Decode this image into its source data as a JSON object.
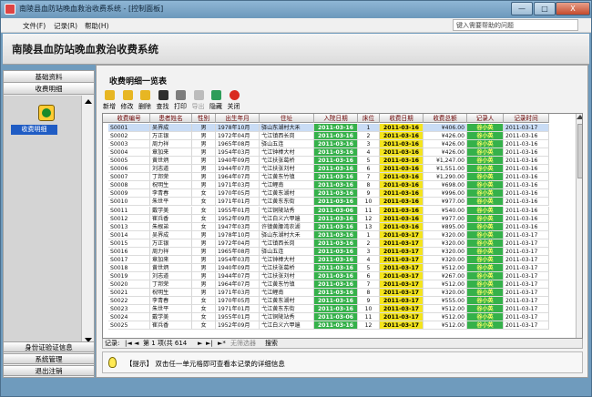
{
  "window": {
    "title": "南陵县血防站晚血救治收费系统 - [控制面板]",
    "buttons": [
      "—",
      "□",
      "X"
    ]
  },
  "menu": {
    "items": [
      "文件(F)",
      "记录(R)",
      "帮助(H)"
    ],
    "help_placeholder": "键入需要帮助的问题"
  },
  "header": {
    "app_title": "南陵县血防站晚血救治收费系统"
  },
  "leftnav": {
    "sections": [
      "基础资料",
      "收费明细"
    ],
    "selected_item": "收费明细",
    "icon": "coins-icon",
    "bottom_sections": [
      "身份证验证信息",
      "系统管理",
      "退出注销"
    ]
  },
  "main": {
    "title": "收费明细一览表",
    "toolbar": [
      {
        "label": "新增",
        "icon": "new-folder-icon",
        "color": "#e7b623"
      },
      {
        "label": "修改",
        "icon": "edit-icon",
        "color": "#e7b623"
      },
      {
        "label": "删除",
        "icon": "delete-icon",
        "color": "#e7b623"
      },
      {
        "label": "查找",
        "icon": "binoculars-icon",
        "color": "#2f2f2f"
      },
      {
        "label": "打印",
        "icon": "printer-icon",
        "color": "#7d7d7d"
      },
      {
        "label": "导出",
        "icon": "export-icon",
        "color": "#bcbcbc"
      },
      {
        "label": "隐藏",
        "icon": "hide-arrow-icon",
        "color": "#2e9d5a"
      },
      {
        "label": "关闭",
        "icon": "close-circle-icon",
        "color": "#d92b1f"
      }
    ],
    "columns": [
      "收费编号",
      "患者姓名",
      "性别",
      "出生年月",
      "住址",
      "入院日期",
      "床位",
      "收费日期",
      "收费总额",
      "记录人",
      "记录时间"
    ],
    "rows": [
      [
        "S0001",
        "吴界成",
        "男",
        "1978年10月",
        "驿山东湖村大禾",
        "2011-03-16",
        "1",
        "2011-03-16",
        "¥406.00",
        "谷小英",
        "2011-03-17"
      ],
      [
        "S0002",
        "万正银",
        "男",
        "1972年04月",
        "弋江镇西长岗",
        "2011-03-16",
        "2",
        "2011-03-16",
        "¥426.00",
        "谷小英",
        "2011-03-16"
      ],
      [
        "S0003",
        "周力祥",
        "男",
        "1965年08月",
        "驿山五连",
        "2011-03-16",
        "3",
        "2011-03-16",
        "¥426.00",
        "谷小英",
        "2011-03-16"
      ],
      [
        "S0004",
        "章加来",
        "男",
        "1954年03月",
        "弋江钟棒大村",
        "2011-03-16",
        "4",
        "2011-03-16",
        "¥426.00",
        "谷小英",
        "2011-03-16"
      ],
      [
        "S0005",
        "黄世炳",
        "男",
        "1940年09月",
        "弋江扶张葛桥",
        "2011-03-16",
        "5",
        "2011-03-16",
        "¥1,247.00",
        "谷小英",
        "2011-03-16"
      ],
      [
        "S0006",
        "刘志道",
        "男",
        "1944年07月",
        "弋江扶张刘村",
        "2011-03-16",
        "6",
        "2011-03-16",
        "¥1,551.00",
        "谷小英",
        "2011-03-16"
      ],
      [
        "S0007",
        "丁邦荣",
        "男",
        "1964年07月",
        "弋江黄东竹镇",
        "2011-03-16",
        "7",
        "2011-03-16",
        "¥1,290.00",
        "谷小英",
        "2011-03-16"
      ],
      [
        "S0008",
        "祝明生",
        "男",
        "1971年03月",
        "弋江鲤南",
        "2011-03-16",
        "8",
        "2011-03-16",
        "¥698.00",
        "谷小英",
        "2011-03-16"
      ],
      [
        "S0009",
        "李青春",
        "女",
        "1970年05月",
        "弋江黄东湖村",
        "2011-03-16",
        "9",
        "2011-03-16",
        "¥996.00",
        "谷小英",
        "2011-03-16"
      ],
      [
        "S0010",
        "朱世平",
        "女",
        "1971年01月",
        "弋江黄东东街",
        "2011-03-16",
        "10",
        "2011-03-16",
        "¥977.00",
        "谷小英",
        "2011-03-16"
      ],
      [
        "S0011",
        "戴学美",
        "女",
        "1955年01月",
        "弋江铜陵站秀",
        "2011-03-06",
        "11",
        "2011-03-16",
        "¥540.00",
        "谷小英",
        "2011-03-16"
      ],
      [
        "S0012",
        "崔兵香",
        "女",
        "1952年09月",
        "弋江白义六甲遍",
        "2011-03-16",
        "12",
        "2011-03-16",
        "¥977.00",
        "谷小英",
        "2011-03-16"
      ],
      [
        "S0013",
        "朱根弟",
        "女",
        "1947年03月",
        "许镇黄腰湾农湖",
        "2011-03-16",
        "13",
        "2011-03-16",
        "¥895.00",
        "谷小英",
        "2011-03-16"
      ],
      [
        "S0014",
        "吴界成",
        "男",
        "1978年10月",
        "驿山东湖村大禾",
        "2011-03-16",
        "1",
        "2011-03-17",
        "¥320.00",
        "谷小英",
        "2011-03-17"
      ],
      [
        "S0015",
        "万正银",
        "男",
        "1972年04月",
        "弋江镇西长岗",
        "2011-03-16",
        "2",
        "2011-03-17",
        "¥320.00",
        "谷小英",
        "2011-03-17"
      ],
      [
        "S0016",
        "周力祥",
        "男",
        "1965年08月",
        "驿山五连",
        "2011-03-16",
        "3",
        "2011-03-17",
        "¥320.00",
        "谷小英",
        "2011-03-17"
      ],
      [
        "S0017",
        "章加来",
        "男",
        "1954年03月",
        "弋江钟棒大村",
        "2011-03-16",
        "4",
        "2011-03-17",
        "¥320.00",
        "谷小英",
        "2011-03-17"
      ],
      [
        "S0018",
        "黄世炳",
        "男",
        "1940年09月",
        "弋江扶张葛桥",
        "2011-03-16",
        "5",
        "2011-03-17",
        "¥512.00",
        "谷小英",
        "2011-03-17"
      ],
      [
        "S0019",
        "刘志道",
        "男",
        "1944年07月",
        "弋江扶张刘村",
        "2011-03-16",
        "6",
        "2011-03-17",
        "¥267.00",
        "谷小英",
        "2011-03-17"
      ],
      [
        "S0020",
        "丁邦荣",
        "男",
        "1964年07月",
        "弋江黄东竹镇",
        "2011-03-16",
        "7",
        "2011-03-17",
        "¥512.00",
        "谷小英",
        "2011-03-17"
      ],
      [
        "S0021",
        "祝明生",
        "男",
        "1971年03月",
        "弋江鲤南",
        "2011-03-16",
        "8",
        "2011-03-17",
        "¥320.00",
        "谷小英",
        "2011-03-17"
      ],
      [
        "S0022",
        "李青春",
        "女",
        "1970年05月",
        "弋江黄东湖村",
        "2011-03-16",
        "9",
        "2011-03-17",
        "¥555.00",
        "谷小英",
        "2011-03-17"
      ],
      [
        "S0023",
        "朱世平",
        "女",
        "1971年01月",
        "弋江黄东东街",
        "2011-03-16",
        "10",
        "2011-03-17",
        "¥512.00",
        "谷小英",
        "2011-03-17"
      ],
      [
        "S0024",
        "戴学美",
        "女",
        "1955年01月",
        "弋江铜陵站秀",
        "2011-03-06",
        "11",
        "2011-03-17",
        "¥512.00",
        "谷小英",
        "2011-03-17"
      ],
      [
        "S0025",
        "崔兵香",
        "女",
        "1952年09月",
        "弋江白义六甲遍",
        "2011-03-16",
        "12",
        "2011-03-17",
        "¥512.00",
        "谷小英",
        "2011-03-17"
      ]
    ],
    "navbar": {
      "record_label": "记录:",
      "position": "第 1 项(共 614",
      "filter_label": "无筛选器",
      "search_label": "搜索"
    },
    "tip": "【提示】 双击任一单元格即可查看本记录的详细信息"
  },
  "colors": {
    "title_bar": "#7aa3c4",
    "admission_date_bg": "#35b14a",
    "fee_date_bg": "#f4e51c",
    "recorder_bg": "#35b14a",
    "nav_selected_bg": "#1f5cc4"
  }
}
